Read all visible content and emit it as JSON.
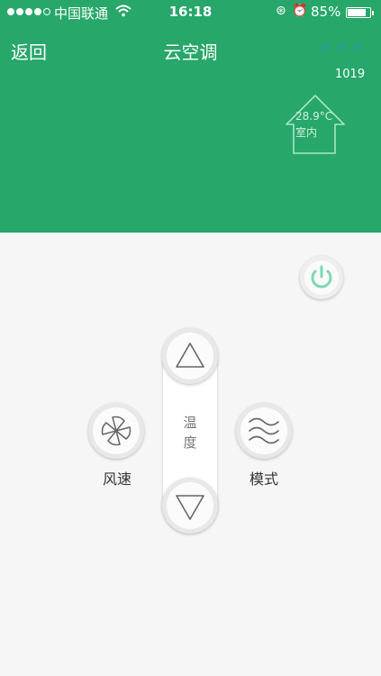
{
  "status_bar": {
    "carrier": "中国联通",
    "time": "16:18",
    "battery": "85%",
    "battery_level": 0.85,
    "signal_bars": 4,
    "icons": [
      "wifi-icon",
      "orientation-lock-icon",
      "location-icon",
      "alarm-icon"
    ]
  },
  "nav": {
    "back": "返回",
    "title": "云空调",
    "more_icon": "more-dots-icon"
  },
  "device": {
    "id": "1019",
    "indoor_temperature": "28.9°C",
    "indoor_label": "室内"
  },
  "controls": {
    "temperature_label_1": "温",
    "temperature_label_2": "度",
    "fan_label": "风速",
    "mode_label": "模式",
    "power_icon": "power-icon",
    "up_icon": "triangle-up-icon",
    "down_icon": "triangle-down-icon",
    "fan_icon": "fan-icon",
    "mode_icon": "waves-icon"
  },
  "colors": {
    "header_green": "#27a76a",
    "power_green": "#7dd8b0",
    "more_dots_blue": "#2d8de0"
  }
}
